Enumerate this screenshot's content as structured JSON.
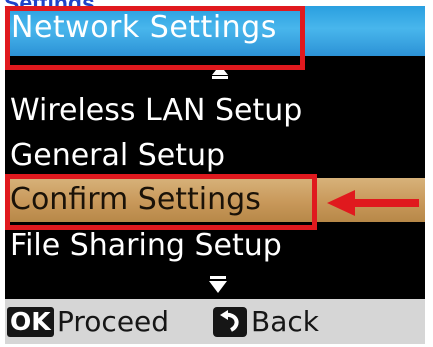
{
  "page_heading_fragment": "Settings",
  "screen": {
    "title": "Network Settings",
    "menu": [
      {
        "label": "Wireless LAN Setup",
        "selected": false
      },
      {
        "label": "General Setup",
        "selected": false
      },
      {
        "label": "Confirm Settings",
        "selected": true
      },
      {
        "label": "File Sharing Setup",
        "selected": false
      }
    ],
    "footer": {
      "ok_key": "OK",
      "ok_action": "Proceed",
      "back_action": "Back"
    }
  },
  "icons": {
    "scroll_up": "triangle-up-icon",
    "scroll_down": "triangle-down-icon",
    "back_key": "back-arrow-icon",
    "pointer": "left-arrow-icon"
  },
  "colors": {
    "title_bar": "#2a9fe0",
    "selected_item": "#c8985a",
    "highlight_box": "#e0191e",
    "footer": "#d6d6d6",
    "screen_bg": "#000000",
    "heading_link": "#1f43c8"
  }
}
